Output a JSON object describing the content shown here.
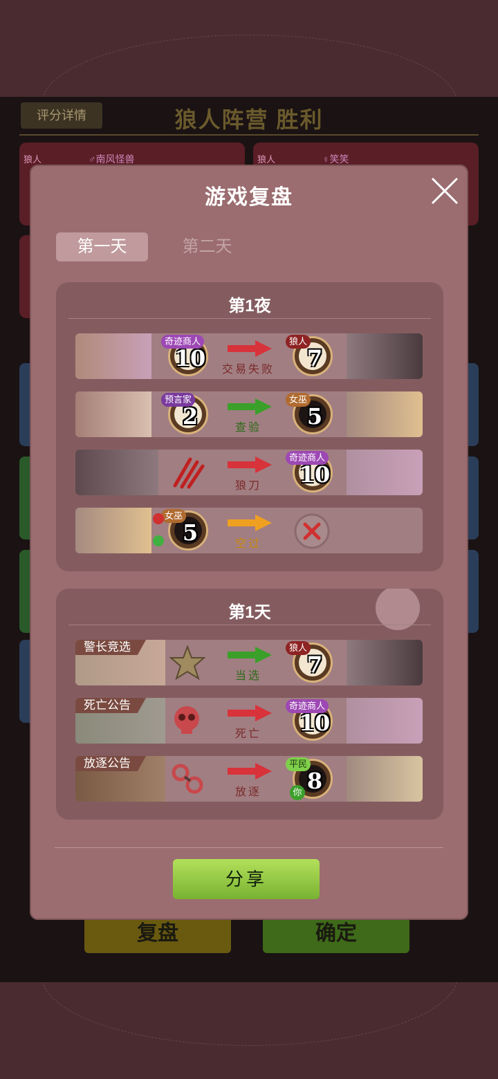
{
  "background": {
    "score_details": "评分详情",
    "result_title": "狼人阵营 胜利",
    "cards": [
      {
        "role": "狼人",
        "name": "♂南风怪兽"
      },
      {
        "role": "狼人",
        "name": "♀笑笑"
      }
    ],
    "replay_button": "复盘",
    "confirm_button": "确定"
  },
  "modal": {
    "title": "游戏复盘",
    "tabs": [
      {
        "label": "第一天",
        "active": true
      },
      {
        "label": "第二天",
        "active": false
      }
    ],
    "night": {
      "title": "第1夜",
      "rows": [
        {
          "actor_role": "奇迹商人",
          "actor_seat": "10",
          "action": "交易失败",
          "arrow": "red",
          "target_role": "狼人",
          "target_seat": "7"
        },
        {
          "actor_role": "预言家",
          "actor_seat": "2",
          "action": "查验",
          "arrow": "green",
          "target_role": "女巫",
          "target_seat": "5"
        },
        {
          "actor_role": "",
          "actor_seat": "",
          "action": "狼刀",
          "arrow": "red",
          "target_role": "奇迹商人",
          "target_seat": "10"
        },
        {
          "actor_role": "女巫",
          "actor_seat": "5",
          "action": "空过",
          "arrow": "orange",
          "target_role": "",
          "target_seat": ""
        }
      ]
    },
    "day": {
      "title": "第1天",
      "rows": [
        {
          "event": "警长竞选",
          "action": "当选",
          "arrow": "green",
          "target_role": "狼人",
          "target_seat": "7"
        },
        {
          "event": "死亡公告",
          "action": "死亡",
          "arrow": "red",
          "target_role": "奇迹商人",
          "target_seat": "10"
        },
        {
          "event": "放逐公告",
          "action": "放逐",
          "arrow": "red",
          "target_role": "平民",
          "target_seat": "8",
          "you_badge": "你"
        }
      ]
    },
    "share_button": "分享"
  },
  "colors": {
    "arrow_red": "#d8323a",
    "arrow_green": "#3aa02a",
    "arrow_orange": "#f0a020",
    "modal_bg": "#9b6d70",
    "share_green": "#8cc63e"
  },
  "icons": [
    "close-icon",
    "wolf-claw-icon",
    "cross-icon",
    "sheriff-badge-icon",
    "skull-icon",
    "handcuffs-icon",
    "arrow-right-icon"
  ]
}
